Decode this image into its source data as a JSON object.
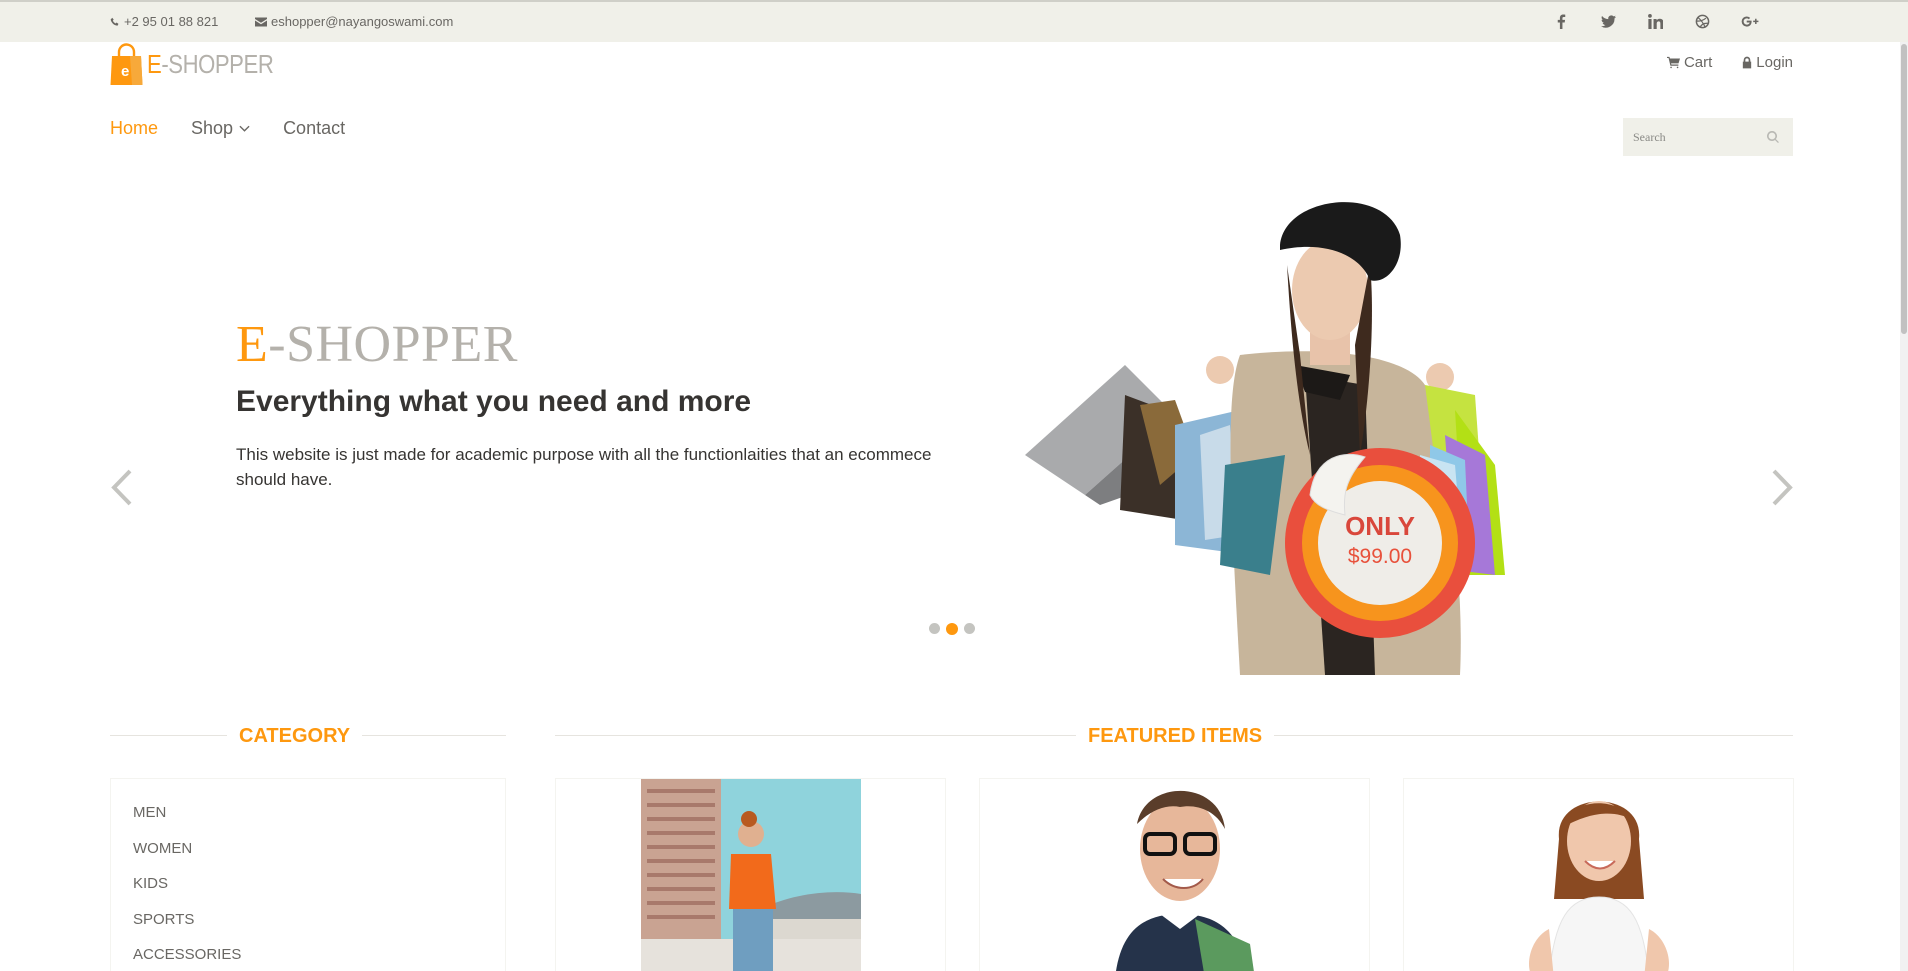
{
  "topbar": {
    "phone": "+2 95 01 88 821",
    "email": "eshopper@nayangoswami.com",
    "social_icons": [
      "facebook-icon",
      "twitter-icon",
      "linkedin-icon",
      "dribbble-icon",
      "google-plus-icon"
    ]
  },
  "logo": {
    "bag_letter": "e",
    "brand_first": "E",
    "brand_rest": "-SHOPPER"
  },
  "shop_menu": {
    "cart": "Cart",
    "login": "Login"
  },
  "nav": {
    "home": "Home",
    "shop": "Shop",
    "contact": "Contact"
  },
  "search": {
    "placeholder": "Search"
  },
  "slider": {
    "title_first": "E",
    "title_rest": "-SHOPPER",
    "subtitle": "Everything what you need and more",
    "description": "This website is just made for academic purpose with all the functionlaities that an ecommece should have.",
    "badge_top": "ONLY",
    "badge_price": "$99.00",
    "active_slide": 2,
    "slide_count": 3
  },
  "sections": {
    "category": "CATEGORY",
    "featured": "FEATURED ITEMS"
  },
  "categories": [
    "MEN",
    "WOMEN",
    "KIDS",
    "SPORTS",
    "ACCESSORIES"
  ],
  "colors": {
    "accent": "#FE980F",
    "topbar_bg": "#F0F0E9",
    "text": "#696763",
    "heading": "#363432"
  }
}
